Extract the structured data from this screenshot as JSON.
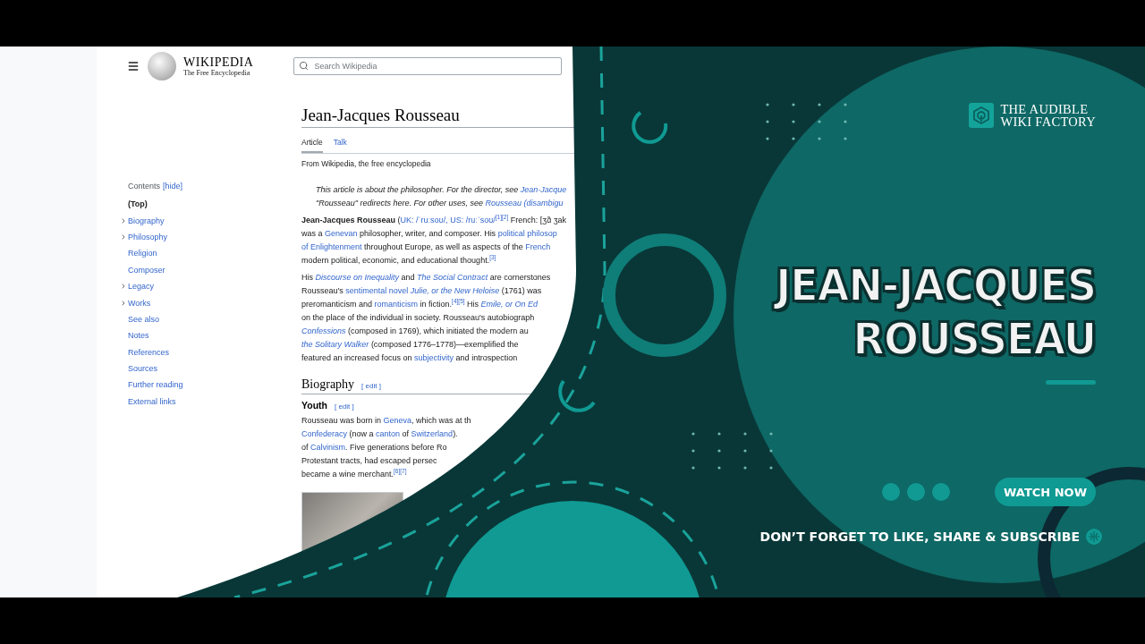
{
  "wiki": {
    "wordmark": "WIKIPEDIA",
    "tagline": "The Free Encyclopedia",
    "search": {
      "placeholder": "Search Wikipedia"
    },
    "contents": {
      "title": "Contents",
      "toggle": "[hide]",
      "items": [
        {
          "label": "(Top)",
          "selected": true,
          "expandable": false
        },
        {
          "label": "Biography",
          "selected": false,
          "expandable": true
        },
        {
          "label": "Philosophy",
          "selected": false,
          "expandable": true
        },
        {
          "label": "Religion",
          "selected": false,
          "expandable": false
        },
        {
          "label": "Composer",
          "selected": false,
          "expandable": false
        },
        {
          "label": "Legacy",
          "selected": false,
          "expandable": true
        },
        {
          "label": "Works",
          "selected": false,
          "expandable": true
        },
        {
          "label": "See also",
          "selected": false,
          "expandable": false
        },
        {
          "label": "Notes",
          "selected": false,
          "expandable": false
        },
        {
          "label": "References",
          "selected": false,
          "expandable": false
        },
        {
          "label": "Sources",
          "selected": false,
          "expandable": false
        },
        {
          "label": "Further reading",
          "selected": false,
          "expandable": false
        },
        {
          "label": "External links",
          "selected": false,
          "expandable": false
        }
      ]
    },
    "article": {
      "title": "Jean-Jacques Rousseau",
      "tabs": [
        {
          "label": "Article",
          "selected": true
        },
        {
          "label": "Talk",
          "selected": false
        }
      ],
      "from": "From Wikipedia, the free encyclopedia",
      "blocks": [
        {
          "kind": "hatnote",
          "lines": [
            [
              {
                "kind": "plain",
                "text": "This article is about the philosopher. For the director, see "
              },
              {
                "kind": "link",
                "text": "Jean-Jacque"
              }
            ],
            [
              {
                "kind": "plain",
                "text": "\"Rousseau\" redirects here. For other uses, see "
              },
              {
                "kind": "link",
                "text": "Rousseau (disambigu"
              }
            ]
          ]
        },
        {
          "kind": "paragraph",
          "lines": [
            [
              {
                "kind": "bold",
                "text": "Jean-Jacques Rousseau"
              },
              {
                "kind": "plain",
                "text": " ("
              },
              {
                "kind": "link",
                "text": "UK: /ˈruːsoʊ/, US: /ruːˈsoʊ/"
              },
              {
                "kind": "sup",
                "text": "[1][2]"
              },
              {
                "kind": "plain",
                "text": " French: [ʒɑ̃ ʒak"
              }
            ],
            [
              {
                "kind": "plain",
                "text": "was a "
              },
              {
                "kind": "link",
                "text": "Genevan"
              },
              {
                "kind": "plain",
                "text": " philosopher, writer, and composer. His "
              },
              {
                "kind": "link",
                "text": "political philosop"
              }
            ],
            [
              {
                "kind": "link",
                "text": "of Enlightenment"
              },
              {
                "kind": "plain",
                "text": " throughout Europe, as well as aspects of the "
              },
              {
                "kind": "link",
                "text": "French"
              }
            ],
            [
              {
                "kind": "plain",
                "text": "modern political, economic, and educational thought."
              },
              {
                "kind": "sup",
                "text": "[3]"
              }
            ]
          ]
        },
        {
          "kind": "paragraph",
          "lines": [
            [
              {
                "kind": "plain",
                "text": "His "
              },
              {
                "kind": "ilink",
                "text": "Discourse on Inequality"
              },
              {
                "kind": "plain",
                "text": " and "
              },
              {
                "kind": "ilink",
                "text": "The Social Contract"
              },
              {
                "kind": "plain",
                "text": " are cornerstones"
              }
            ],
            [
              {
                "kind": "plain",
                "text": "Rousseau's "
              },
              {
                "kind": "link",
                "text": "sentimental novel "
              },
              {
                "kind": "ilink",
                "text": "Julie, or the New Heloise"
              },
              {
                "kind": "plain",
                "text": " (1761) was"
              }
            ],
            [
              {
                "kind": "plain",
                "text": "preromanticism and "
              },
              {
                "kind": "link",
                "text": "romanticism"
              },
              {
                "kind": "plain",
                "text": " in fiction."
              },
              {
                "kind": "sup",
                "text": "[4][5]"
              },
              {
                "kind": "plain",
                "text": " His "
              },
              {
                "kind": "ilink",
                "text": "Emile, or On Ed"
              }
            ],
            [
              {
                "kind": "plain",
                "text": "on the place of the individual in society. Rousseau's autobiograph"
              }
            ],
            [
              {
                "kind": "ilink",
                "text": "Confessions"
              },
              {
                "kind": "plain",
                "text": " (composed in 1769), which initiated the modern au"
              }
            ],
            [
              {
                "kind": "ilink",
                "text": "the Solitary Walker"
              },
              {
                "kind": "plain",
                "text": " (composed 1776–1778)—exemplified the"
              }
            ],
            [
              {
                "kind": "plain",
                "text": "featured an increased focus on "
              },
              {
                "kind": "link",
                "text": "subjectivity"
              },
              {
                "kind": "plain",
                "text": " and introspection"
              }
            ]
          ]
        },
        {
          "kind": "heading",
          "text": "Biography",
          "edit": "[ edit ]"
        },
        {
          "kind": "subheading",
          "text": "Youth",
          "edit": "[ edit ]"
        },
        {
          "kind": "paragraph",
          "lines": [
            [
              {
                "kind": "plain",
                "text": "Rousseau was born in "
              },
              {
                "kind": "link",
                "text": "Geneva"
              },
              {
                "kind": "plain",
                "text": ", which was at th"
              }
            ],
            [
              {
                "kind": "link",
                "text": "Confederacy"
              },
              {
                "kind": "plain",
                "text": " (now a "
              },
              {
                "kind": "link",
                "text": "canton"
              },
              {
                "kind": "plain",
                "text": " of "
              },
              {
                "kind": "link",
                "text": "Switzerland"
              },
              {
                "kind": "plain",
                "text": ")."
              }
            ],
            [
              {
                "kind": "plain",
                "text": "of "
              },
              {
                "kind": "link",
                "text": "Calvinism"
              },
              {
                "kind": "plain",
                "text": ". Five generations before Ro"
              }
            ],
            [
              {
                "kind": "plain",
                "text": "Protestant tracts, had escaped persec"
              }
            ],
            [
              {
                "kind": "plain",
                "text": "became a wine merchant."
              },
              {
                "kind": "sup",
                "text": "[6][7]"
              }
            ]
          ]
        },
        {
          "kind": "photo"
        }
      ]
    }
  },
  "promo": {
    "brand": [
      "THE AUDIBLE",
      "WIKI FACTORY"
    ],
    "title_lines": [
      "JEAN-JACQUES",
      "ROUSSEAU"
    ],
    "watch_button": "WATCH NOW",
    "subscribe": "DON’T FORGET TO LIKE, SHARE & SUBSCRIBE"
  }
}
